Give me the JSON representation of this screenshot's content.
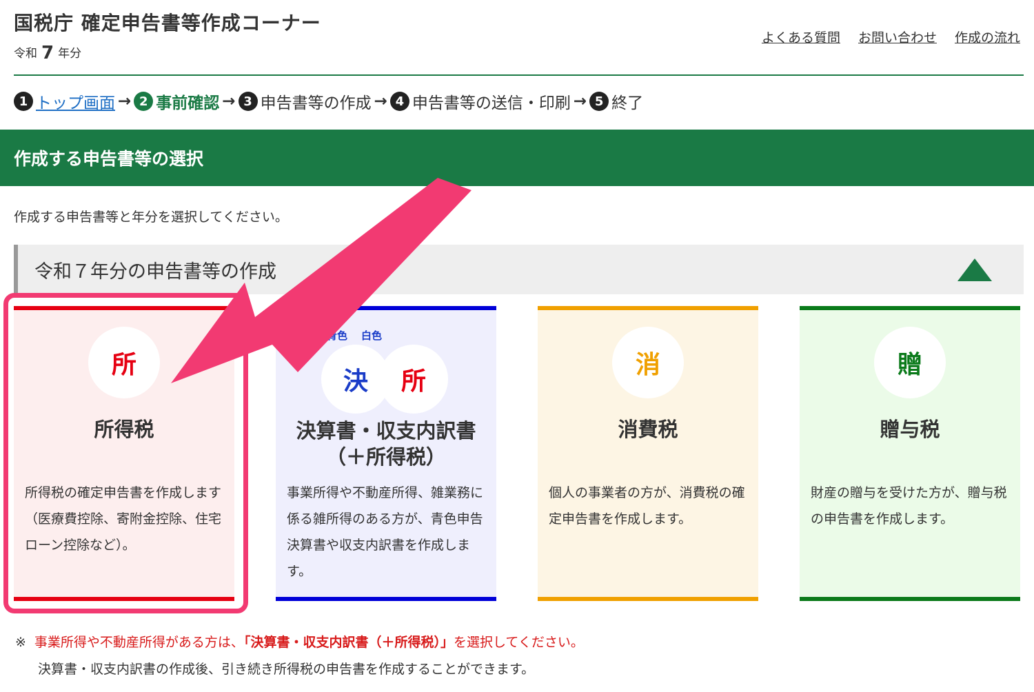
{
  "header": {
    "title": "国税庁 確定申告書等作成コーナー",
    "year_prefix": "令和",
    "year_number": "7",
    "year_suffix": "年分",
    "links": [
      "よくある質問",
      "お問い合わせ",
      "作成の流れ"
    ]
  },
  "steps": [
    {
      "num": "1",
      "label": "トップ画面"
    },
    {
      "num": "2",
      "label": "事前確認"
    },
    {
      "num": "3",
      "label": "申告書等の作成"
    },
    {
      "num": "4",
      "label": "申告書等の送信・印刷"
    },
    {
      "num": "5",
      "label": "終了"
    }
  ],
  "banner": {
    "title": "作成する申告書等の選択"
  },
  "intro": "作成する申告書等と年分を選択してください。",
  "section": {
    "title": "令和７年分の申告書等の作成",
    "toggle_icon": "triangle-up-icon"
  },
  "cards": [
    {
      "icon_char": "所",
      "title": "所得税",
      "desc": "所得税の確定申告書を作成します（医療費控除、寄附金控除、住宅ローン控除など）。",
      "accent": "#e60012",
      "bg": "#fdeeee"
    },
    {
      "badge_blue": "青色",
      "badge_white": "白色",
      "icon_char_1": "決",
      "icon_char_2": "所",
      "title_line1": "決算書・収支内訳書",
      "title_line2": "（＋所得税）",
      "desc": "事業所得や不動産所得、雑業務に係る雑所得のある方が、青色申告決算書や収支内訳書を作成します。",
      "accent": "#0000d8",
      "bg": "#efeffd"
    },
    {
      "icon_char": "消",
      "title": "消費税",
      "desc": "個人の事業者の方が、消費税の確定申告書を作成します。",
      "accent": "#f0a000",
      "bg": "#fdf5e4"
    },
    {
      "icon_char": "贈",
      "title": "贈与税",
      "desc": "財産の贈与を受けた方が、贈与税の申告書を作成します。",
      "accent": "#0a7a1a",
      "bg": "#ebfbe8"
    }
  ],
  "notes": {
    "mark": "※",
    "note1_a": "事業所得や不動産所得がある方は、",
    "note1_b": "「決算書・収支内訳書（＋所得税）」",
    "note1_c": "を選択してください。",
    "note2": "決算書・収支内訳書の作成後、引き続き所得税の申告書を作成することができます。"
  },
  "colors": {
    "brand_green": "#1a7a45",
    "link_blue": "#1f6fc5",
    "highlight_pink": "#f23a72"
  }
}
